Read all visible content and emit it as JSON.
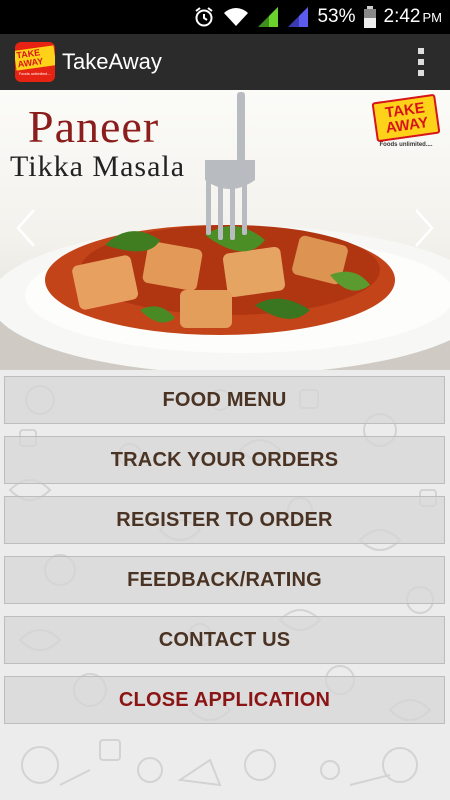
{
  "status_bar": {
    "battery_percent": "53%",
    "time": "2:42",
    "ampm": "PM",
    "icons": [
      "alarm-icon",
      "wifi-icon",
      "signal-icon",
      "signal-icon-2",
      "battery-icon"
    ]
  },
  "action_bar": {
    "logo_text": "TAKE AWAY",
    "logo_sub": "Foods unlimited....",
    "title": "TakeAway",
    "menu_icon": "overflow-menu-icon"
  },
  "banner": {
    "title_line1": "Paneer",
    "title_line2": "Tikka Masala",
    "badge_text": "TAKE AWAY",
    "badge_sub": "Foods unlimited....",
    "colors": {
      "title": "#8b1e1c",
      "badge_bg": "#ffd21a",
      "badge_text": "#d7141a"
    }
  },
  "menu": {
    "items": [
      {
        "label": "FOOD MENU"
      },
      {
        "label": "TRACK YOUR ORDERS"
      },
      {
        "label": "REGISTER TO ORDER"
      },
      {
        "label": "FEEDBACK/RATING"
      },
      {
        "label": "CONTACT US"
      },
      {
        "label": "CLOSE APPLICATION"
      }
    ],
    "colors": {
      "label": "#4a3323",
      "close_label": "#8b1414"
    }
  }
}
